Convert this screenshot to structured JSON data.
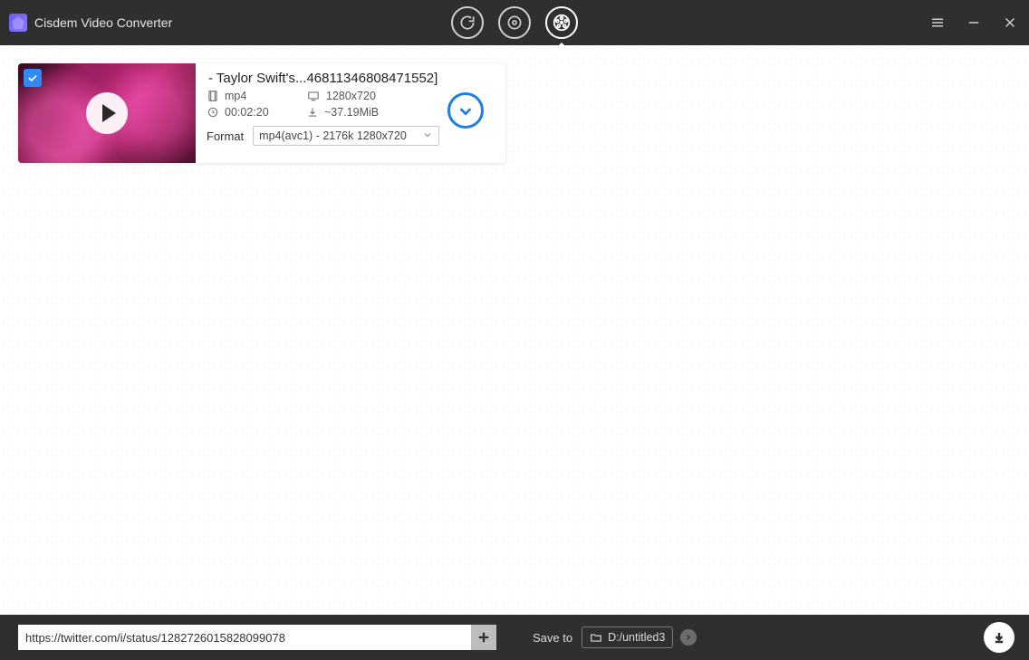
{
  "app": {
    "title": "Cisdem Video Converter"
  },
  "item": {
    "title": " - Taylor Swift's...46811346808471552]",
    "container": "mp4",
    "resolution": "1280x720",
    "duration": "00:02:20",
    "size": "~37.19MiB",
    "format_label": "Format",
    "format_value": "mp4(avc1) - 2176k 1280x720"
  },
  "bottom": {
    "url": "https://twitter.com/i/status/1282726015828099078",
    "save_to_label": "Save to",
    "save_to_path": "D:/untitled3"
  }
}
